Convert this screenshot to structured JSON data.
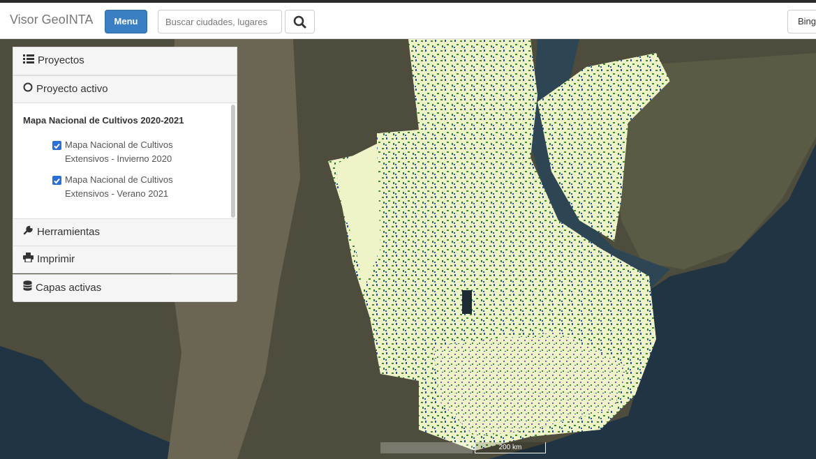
{
  "header": {
    "brand": "Visor GeoINTA",
    "menu_label": "Menu",
    "search_placeholder": "Buscar ciudades, lugares",
    "basemap_label": "Bing"
  },
  "sidebar": {
    "proyectos_label": "Proyectos",
    "proyecto_activo_label": "Proyecto activo",
    "project_title": "Mapa Nacional de Cultivos 2020-2021",
    "layers": [
      {
        "line1": "Mapa Nacional de Cultivos",
        "line2": "Extensivos - Invierno 2020",
        "checked": true
      },
      {
        "line1": "Mapa Nacional de Cultivos",
        "line2": "Extensivos - Verano 2021",
        "checked": true
      }
    ],
    "herramientas_label": "Herramientas",
    "imprimir_label": "Imprimir",
    "capas_label": "Capas activas"
  },
  "map": {
    "scale_label": "200 km",
    "colors": {
      "ocean": "#213444",
      "land": "#4b4a3a",
      "crop_mask": "#eff3c8",
      "crop_green": "#3f8a2c",
      "crop_blue": "#2450b0",
      "crop_purple": "#7a55c8"
    }
  }
}
